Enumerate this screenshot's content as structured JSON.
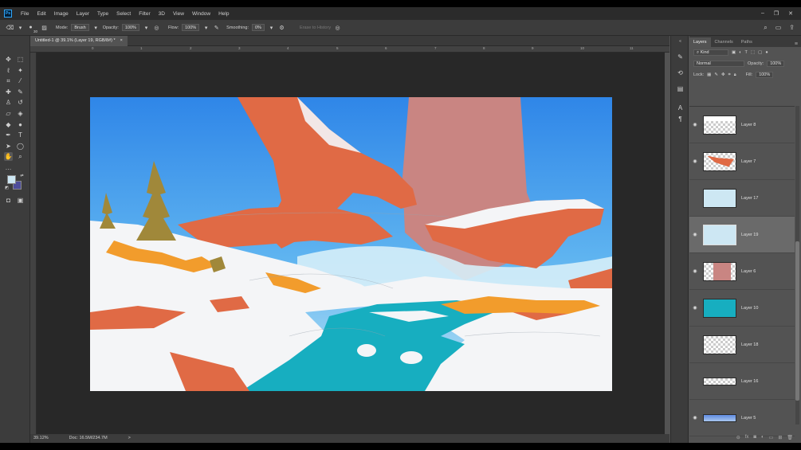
{
  "menubar": {
    "logo": "Ps",
    "items": [
      "File",
      "Edit",
      "Image",
      "Layer",
      "Type",
      "Select",
      "Filter",
      "3D",
      "View",
      "Window",
      "Help"
    ],
    "window_controls": [
      "–",
      "❐",
      "✕"
    ]
  },
  "options_bar": {
    "brush_size": "30",
    "mode_label": "Mode:",
    "mode_value": "Brush",
    "opacity_label": "Opacity:",
    "opacity_value": "100%",
    "flow_label": "Flow:",
    "flow_value": "100%",
    "smoothing_label": "Smoothing:",
    "smoothing_value": "0%",
    "erase_to_history": "Erase to History"
  },
  "document": {
    "tab_title": "Untitled-1 @ 39.1% (Layer 19, RGB/8#) *",
    "close": "×"
  },
  "ruler": {
    "ticks": [
      "0",
      "1",
      "2",
      "3",
      "4",
      "5",
      "6",
      "7",
      "8",
      "9",
      "10",
      "11"
    ]
  },
  "status": {
    "zoom": "39.12%",
    "doc_size": "Doc: 16.5M/234.7M",
    "arrow": ">"
  },
  "layers_panel": {
    "tabs": [
      "Layers",
      "Channels",
      "Paths"
    ],
    "filter_label": "Kind",
    "blend_mode": "Normal",
    "opacity_label": "Opacity:",
    "opacity_value": "100%",
    "lock_label": "Lock:",
    "fill_label": "Fill:",
    "fill_value": "100%",
    "layers": [
      {
        "name": "Layer 8",
        "visible": true,
        "active": false,
        "thumb": "snow"
      },
      {
        "name": "Layer 7",
        "visible": true,
        "active": false,
        "thumb": "rock"
      },
      {
        "name": "Layer 17",
        "visible": false,
        "active": false,
        "thumb": "lightblue"
      },
      {
        "name": "Layer 19",
        "visible": true,
        "active": true,
        "thumb": "lightblue-active"
      },
      {
        "name": "Layer 6",
        "visible": true,
        "active": false,
        "thumb": "pink"
      },
      {
        "name": "Layer 10",
        "visible": true,
        "active": false,
        "thumb": "teal"
      },
      {
        "name": "Layer 18",
        "visible": false,
        "active": false,
        "thumb": "empty"
      },
      {
        "name": "Layer 16",
        "visible": false,
        "active": false,
        "thumb": "empty2"
      },
      {
        "name": "Layer 5",
        "visible": true,
        "active": false,
        "thumb": "sky"
      }
    ],
    "footer_icons": [
      "link",
      "fx",
      "mask",
      "adjust",
      "folder",
      "new",
      "trash"
    ]
  },
  "colors": {
    "foreground": "#cde7f3",
    "background": "#4d4d9a",
    "sky_top": "#2f86e8",
    "sky_bottom": "#9fd6f0",
    "rock": "#e06a45",
    "pillar": "#c98582",
    "snow": "#f4f5f7",
    "water": "#17aec0",
    "grass": "#f29c2c",
    "tree": "#a0883a"
  }
}
